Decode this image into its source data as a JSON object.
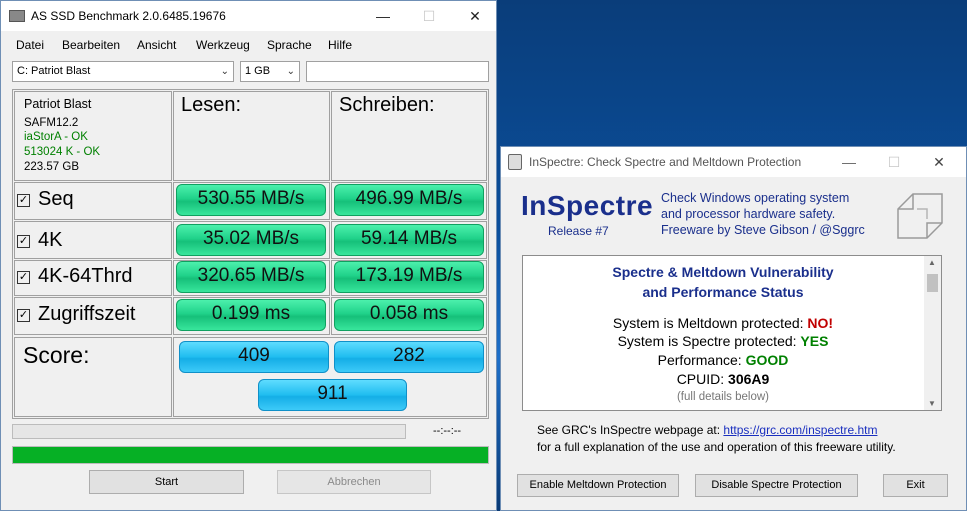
{
  "asssd": {
    "title": "AS SSD Benchmark 2.0.6485.19676",
    "menu": [
      "Datei",
      "Bearbeiten",
      "Ansicht",
      "Werkzeug",
      "Sprache",
      "Hilfe"
    ],
    "drive_select": "C: Patriot Blast",
    "size_select": "1 GB",
    "drive_info": {
      "name": "Patriot Blast",
      "firmware": "SAFM12.2",
      "driver": "iaStorA - OK",
      "alignment": "513024 K - OK",
      "capacity": "223.57 GB"
    },
    "col_read": "Lesen:",
    "col_write": "Schreiben:",
    "rows": [
      {
        "label": "Seq",
        "read": "530.55 MB/s",
        "write": "496.99 MB/s"
      },
      {
        "label": "4K",
        "read": "35.02 MB/s",
        "write": "59.14 MB/s"
      },
      {
        "label": "4K-64Thrd",
        "read": "320.65 MB/s",
        "write": "173.19 MB/s"
      },
      {
        "label": "Zugriffszeit",
        "read": "0.199 ms",
        "write": "0.058 ms"
      }
    ],
    "score_label": "Score:",
    "score_read": "409",
    "score_write": "282",
    "score_total": "911",
    "time_display": "--:--:--",
    "progress_fraction": 1.0,
    "start_label": "Start",
    "abort_label": "Abbrechen",
    "colors": {
      "result_green": "#20d28a",
      "score_blue": "#20bdf0",
      "progress_green": "#06b025",
      "ok_green": "#008000"
    }
  },
  "inspectre": {
    "title": "InSpectre: Check Spectre and Meltdown Protection",
    "logo": "InSpectre",
    "release": "Release #7",
    "desc1": "Check Windows operating system",
    "desc2": "and processor hardware safety.",
    "desc3": "Freeware by Steve Gibson / @Sggrc",
    "status_heading1": "Spectre & Meltdown Vulnerability",
    "status_heading2": "and Performance Status",
    "meltdown_label": "System is Meltdown protected:",
    "meltdown_value": "NO!",
    "spectre_label": "System is Spectre protected:",
    "spectre_value": "YES",
    "performance_label": "Performance:",
    "performance_value": "GOOD",
    "cpuid_label": "CPUID:",
    "cpuid_value": "306A9",
    "details": "(full details below)",
    "footer1_prefix": "See GRC's InSpectre webpage at:",
    "footer1_link": "https://grc.com/inspectre.htm",
    "footer2": "for a full explanation of the use and operation of this freeware utility.",
    "btn_meltdown": "Enable Meltdown Protection",
    "btn_spectre": "Disable Spectre Protection",
    "btn_exit": "Exit",
    "colors": {
      "no": "#c00000",
      "yes": "#008000",
      "heading": "#1a2f8c"
    }
  }
}
